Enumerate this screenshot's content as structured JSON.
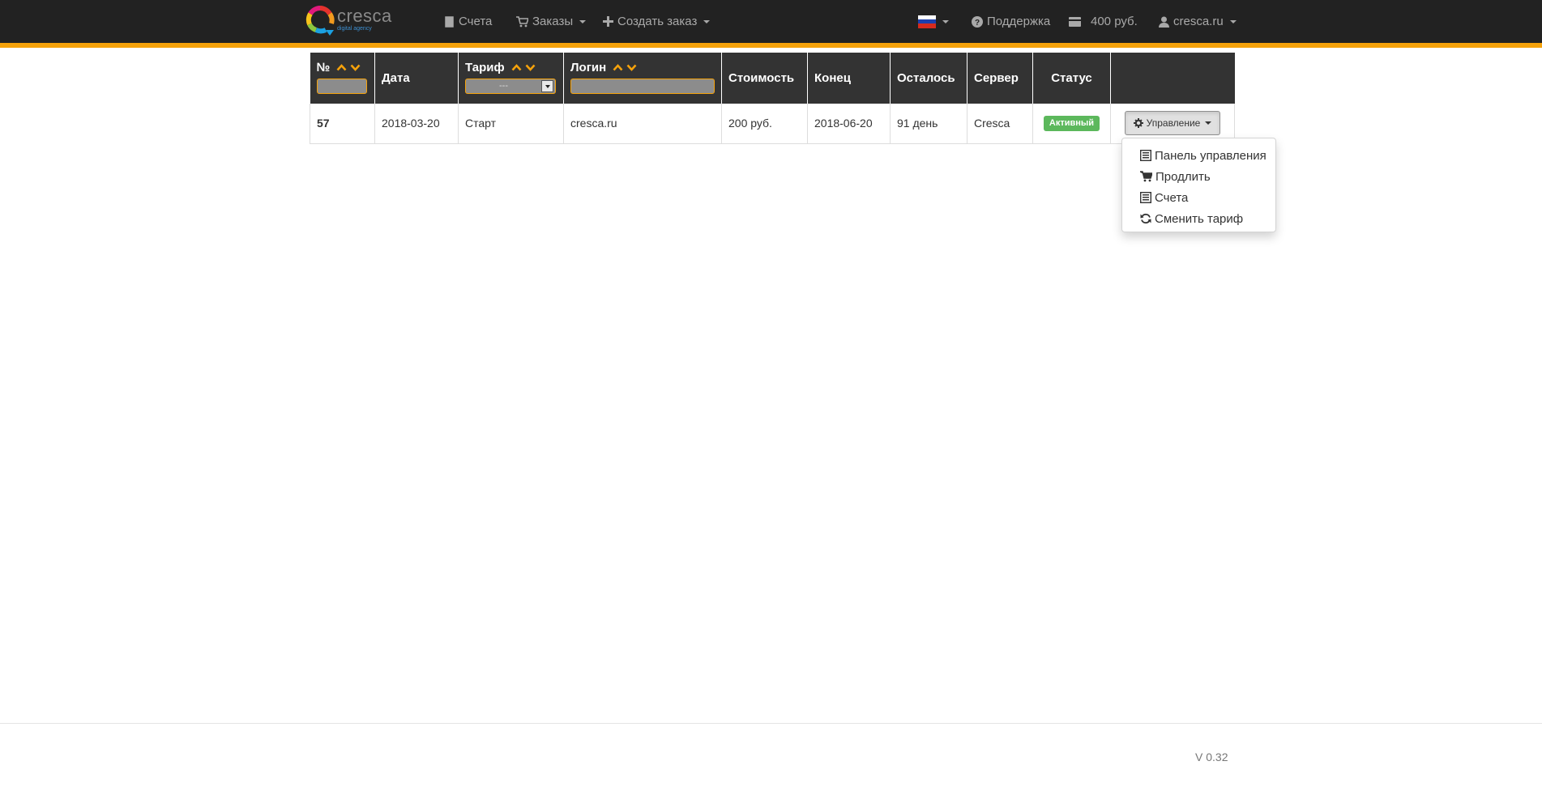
{
  "brand": {
    "name": "cresca",
    "tagline": "digital agency"
  },
  "nav": {
    "invoices": "Счета",
    "orders": "Заказы",
    "create_order": "Создать заказ",
    "support": "Поддержка",
    "balance": "400 руб.",
    "user": "cresca.ru",
    "language_flag": "russia-flag"
  },
  "table": {
    "columns": [
      "№",
      "Дата",
      "Тариф",
      "Логин",
      "Стоимость",
      "Конец",
      "Осталось",
      "Сервер",
      "Статус"
    ],
    "tariff_filter_value": "---",
    "rows": [
      {
        "id": "57",
        "date": "2018-03-20",
        "tariff": "Старт",
        "login": "cresca.ru",
        "cost": "200 руб.",
        "end": "2018-06-20",
        "remaining": "91 день",
        "server": "Cresca",
        "status": "Активный",
        "action": "Управление"
      }
    ]
  },
  "dropdown": {
    "items": [
      "Панель управления",
      "Продлить",
      "Счета",
      "Сменить тариф"
    ]
  },
  "footer": {
    "version": "V 0.32"
  },
  "colors": {
    "navbar_bg": "#222222",
    "accent": "#f5a20b",
    "table_header_bg": "#333333",
    "status_active": "#5cb85c"
  }
}
